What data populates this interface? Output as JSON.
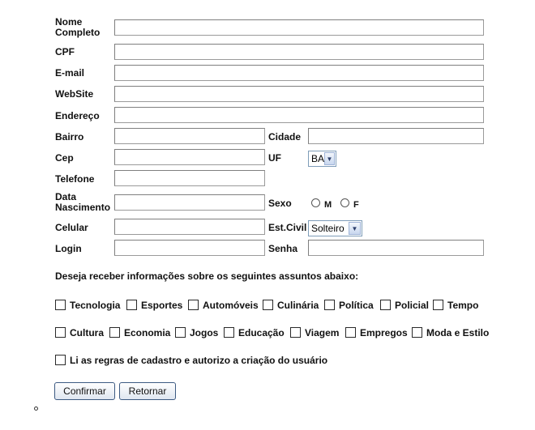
{
  "form": {
    "nome_label": "Nome Completo",
    "cpf_label": "CPF",
    "email_label": "E-mail",
    "website_label": "WebSite",
    "endereco_label": "Endereço",
    "bairro_label": "Bairro",
    "cidade_label": "Cidade",
    "cep_label": "Cep",
    "uf_label": "UF",
    "uf_value": "BA",
    "telefone_label": "Telefone",
    "nascimento_label": "Data Nascimento",
    "sexo_label": "Sexo",
    "sexo_m": "M",
    "sexo_f": "F",
    "celular_label": "Celular",
    "estcivil_label": "Est.Civil",
    "estcivil_value": "Solteiro",
    "login_label": "Login",
    "senha_label": "Senha"
  },
  "interests": {
    "prompt": "Deseja receber informações sobre os seguintes assuntos abaixo:",
    "row1": [
      "Tecnologia",
      "Esportes",
      "Automóveis",
      "Culinária",
      "Política",
      "Policial",
      "Tempo"
    ],
    "row2": [
      "Cultura",
      "Economia",
      "Jogos",
      "Educação",
      "Viagem",
      "Empregos",
      "Moda e Estilo"
    ]
  },
  "agreement": {
    "label": "Li as regras de cadastro e autorizo a criação do usuário"
  },
  "buttons": {
    "confirm": "Confirmar",
    "back": "Retornar"
  },
  "icons": {
    "dropdown": "chevron-down-icon",
    "list_bullet": "bullet-icon"
  }
}
